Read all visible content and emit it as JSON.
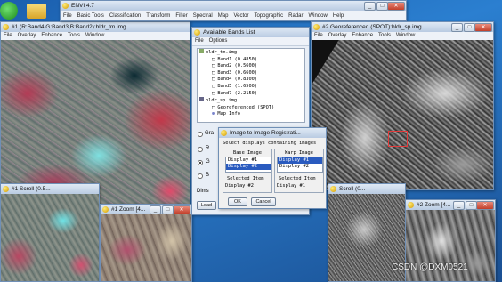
{
  "desktop_icons": [
    {
      "name": "envi-shortcut-icon"
    },
    {
      "name": "folder-icon"
    }
  ],
  "main_menu": {
    "title": "ENVI 4.7",
    "items": [
      "File",
      "Basic Tools",
      "Classification",
      "Transform",
      "Filter",
      "Spectral",
      "Map",
      "Vector",
      "Topographic",
      "Radar",
      "Window",
      "Help"
    ]
  },
  "display1": {
    "title": "#1 (R:Band4,G:Band3,B:Band2):bldr_tm.img",
    "menu": [
      "File",
      "Overlay",
      "Enhance",
      "Tools",
      "Window"
    ]
  },
  "scroll1": {
    "title": "#1 Scroll (0.5..."
  },
  "zoom1": {
    "title": "#1 Zoom [4..."
  },
  "bands": {
    "title": "Available Bands List",
    "menu": [
      "File",
      "Options"
    ],
    "tree": [
      {
        "label": "bldr_tm.img",
        "level": 0
      },
      {
        "label": "Band1 (0.4850)",
        "level": 1
      },
      {
        "label": "Band2 (0.5600)",
        "level": 1
      },
      {
        "label": "Band3 (0.6600)",
        "level": 1
      },
      {
        "label": "Band4 (0.8300)",
        "level": 1
      },
      {
        "label": "Band5 (1.6500)",
        "level": 1
      },
      {
        "label": "Band7 (2.2150)",
        "level": 1
      },
      {
        "label": "bldr_sp.img",
        "level": 0
      },
      {
        "label": "Georeferenced (SPOT)",
        "level": 1
      },
      {
        "label": "Map Info",
        "level": 1
      }
    ],
    "gray_label": "Gra",
    "radio_labels": [
      "R",
      "G",
      "B"
    ],
    "dims_label": "Dims",
    "load_label": "Load"
  },
  "display2": {
    "title": "#2 Georeferenced (SPOT):bldr_sp.img",
    "menu": [
      "File",
      "Overlay",
      "Enhance",
      "Tools",
      "Window"
    ]
  },
  "scroll2": {
    "title": "Scroll (0..."
  },
  "zoom2": {
    "title": "#2 Zoom [4..."
  },
  "reg": {
    "title": "Image to Image Registrati...",
    "instruction": "Select displays containing images",
    "base_header": "Base Image",
    "warp_header": "Warp Image",
    "base_items": [
      "Display #1",
      "Display #2"
    ],
    "warp_items": [
      "Display #1",
      "Display #2"
    ],
    "base_selected_index": 1,
    "warp_selected_index": 0,
    "selected_label": "Selected Item",
    "base_selected_value": "Display #2",
    "warp_selected_value": "Display #1",
    "ok_label": "OK",
    "cancel_label": "Cancel"
  },
  "watermark": "CSDN @DXM0521"
}
